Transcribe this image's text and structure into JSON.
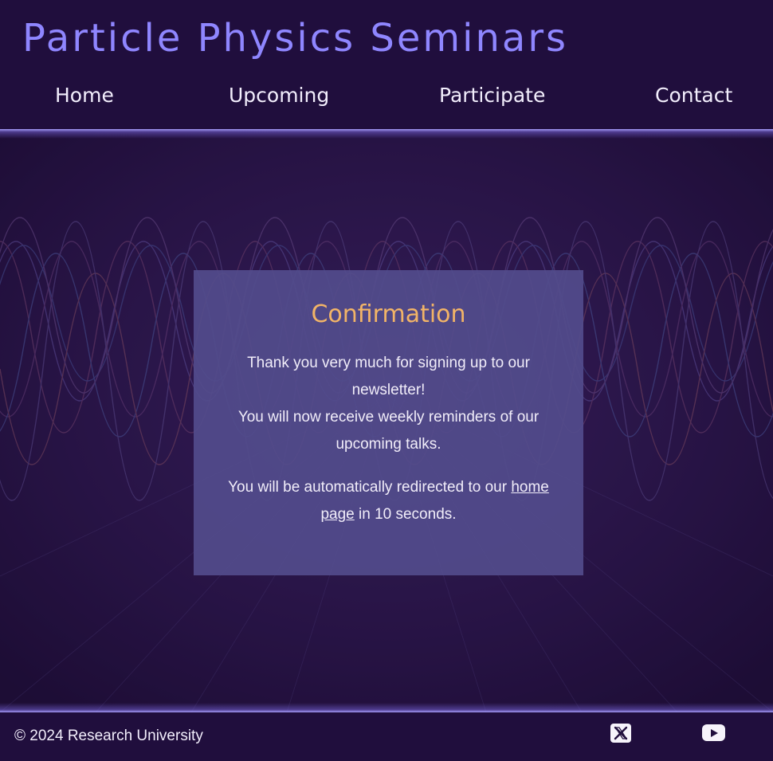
{
  "header": {
    "title": "Particle Physics Seminars"
  },
  "nav": {
    "items": [
      {
        "label": "Home"
      },
      {
        "label": "Upcoming"
      },
      {
        "label": "Participate"
      },
      {
        "label": "Contact"
      }
    ]
  },
  "confirmation": {
    "title": "Confirmation",
    "line1": "Thank you very much for signing up to our newsletter!",
    "line2": "You will now receive weekly reminders of our upcoming talks.",
    "redirect_prefix": "You will be automatically redirected to our",
    "redirect_link": "home page",
    "redirect_suffix": "in 10 seconds."
  },
  "footer": {
    "copyright": "© 2024 Research University",
    "social": [
      {
        "icon": "x-logo-icon"
      },
      {
        "icon": "youtube-icon"
      }
    ]
  },
  "colors": {
    "background": "#200e3d",
    "title": "#8f86ff",
    "card": "#534c8c",
    "card_title": "#f2b467",
    "text": "#f2eefc"
  }
}
